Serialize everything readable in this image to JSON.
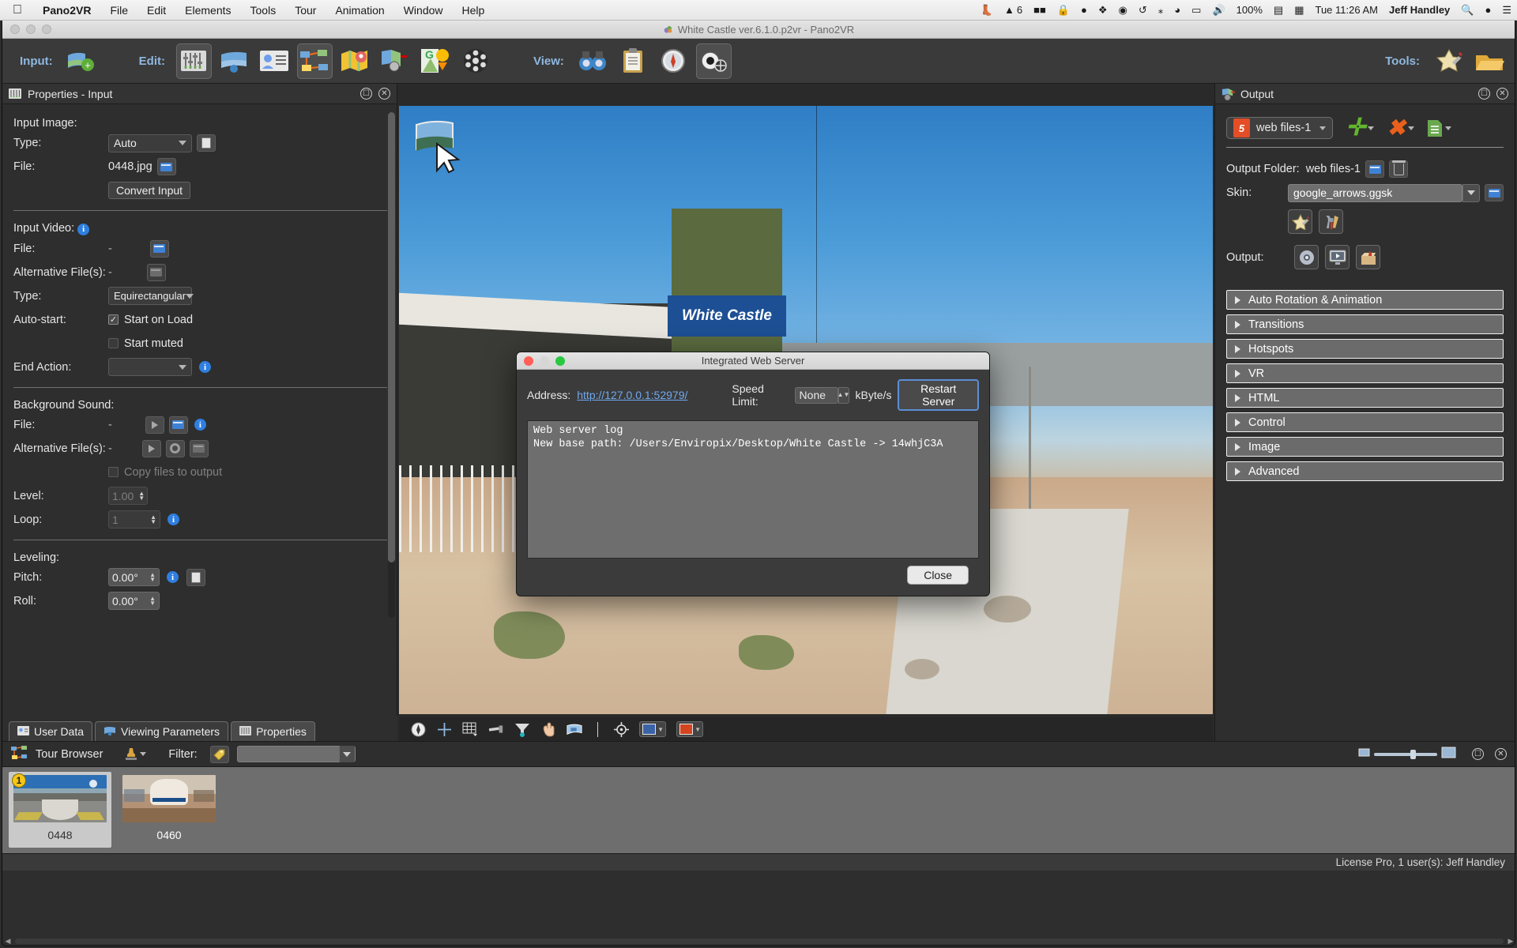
{
  "menubar": {
    "apple_icon": "apple-logo-icon",
    "items": [
      "Pano2VR",
      "File",
      "Edit",
      "Elements",
      "Tools",
      "Tour",
      "Animation",
      "Window",
      "Help"
    ],
    "status": {
      "evernote_icon": "evernote-icon",
      "acrobat_label": "6",
      "wetransfer_icon": "wetransfer-icon",
      "lock_icon": "lock-icon",
      "camera_icon": "camera-icon",
      "dropbox_icon": "dropbox-icon",
      "sophos_icon": "sophos-icon",
      "timemachine_icon": "time-machine-icon",
      "bluetooth_icon": "bluetooth-icon",
      "wifi_icon": "wifi-icon",
      "airplay_icon": "airplay-icon",
      "volume_icon": "volume-icon",
      "battery_percent": "100%",
      "battery_icon": "battery-charging-icon",
      "keyboard_icon": "input-source-icon",
      "clock": "Tue 11:26 AM",
      "user": "Jeff Handley",
      "search_icon": "spotlight-search-icon",
      "siri_icon": "siri-icon",
      "notification_icon": "notification-center-icon"
    }
  },
  "window": {
    "title": "White Castle ver.6.1.0.p2vr - Pano2VR",
    "title_icon": "pano2vr-app-icon"
  },
  "toolbar": {
    "input_label": "Input:",
    "edit_label": "Edit:",
    "view_label": "View:",
    "tools_label": "Tools:",
    "input_buttons": [
      {
        "name": "add-input-image-button",
        "icon": "panorama-add-icon"
      }
    ],
    "edit_buttons": [
      {
        "name": "properties-button",
        "icon": "sliders-icon",
        "selected": true
      },
      {
        "name": "viewing-parameters-button",
        "icon": "panorama-view-icon",
        "selected": false
      },
      {
        "name": "user-data-button",
        "icon": "user-card-icon",
        "selected": false
      },
      {
        "name": "tour-browser-button",
        "icon": "tour-nodes-icon",
        "selected": true
      },
      {
        "name": "tour-map-button",
        "icon": "map-pin-icon",
        "selected": false
      },
      {
        "name": "hotspot-editor-button",
        "icon": "hotspot-icon",
        "selected": false
      },
      {
        "name": "google-maps-button",
        "icon": "google-maps-icon",
        "selected": false
      },
      {
        "name": "animation-editor-button",
        "icon": "film-reel-icon",
        "selected": false
      }
    ],
    "view_buttons": [
      {
        "name": "binoculars-button",
        "icon": "binoculars-icon"
      },
      {
        "name": "clipboard-button",
        "icon": "clipboard-icon"
      },
      {
        "name": "compass-button",
        "icon": "compass-gauge-icon"
      },
      {
        "name": "preview-button",
        "icon": "preview-eye-icon",
        "selected": true
      }
    ],
    "tools_buttons": [
      {
        "name": "skin-editor-button",
        "icon": "skin-star-icon"
      },
      {
        "name": "output-button",
        "icon": "output-folder-icon"
      }
    ]
  },
  "left_panel": {
    "header": {
      "title": "Properties - Input",
      "icon": "sliders-icon",
      "float_icon": "undock-icon",
      "close_icon": "close-icon"
    },
    "sections": {
      "input_image": {
        "heading": "Input Image:",
        "type_label": "Type:",
        "type_value": "Auto",
        "copy_icon": "copy-icon",
        "file_label": "File:",
        "file_value": "0448.jpg",
        "folder_icon": "open-folder-icon",
        "convert_button": "Convert Input"
      },
      "input_video": {
        "heading": "Input Video:",
        "info_icon": "info-icon",
        "file_label": "File:",
        "file_value": "-",
        "alt_label": "Alternative File(s):",
        "alt_value": "-",
        "type_label": "Type:",
        "type_value": "Equirectangular",
        "autostart_label": "Auto-start:",
        "start_on_load": "Start on Load",
        "start_on_load_checked": true,
        "start_muted": "Start muted",
        "start_muted_checked": false,
        "end_action_label": "End Action:",
        "end_action_value": ""
      },
      "background_sound": {
        "heading": "Background Sound:",
        "file_label": "File:",
        "file_value": "-",
        "alt_label": "Alternative File(s):",
        "alt_value": "-",
        "copy_files_label": "Copy files to output",
        "copy_files_checked": false,
        "level_label": "Level:",
        "level_value": "1.00",
        "loop_label": "Loop:",
        "loop_value": "1"
      },
      "leveling": {
        "heading": "Leveling:",
        "pitch_label": "Pitch:",
        "pitch_value": "0.00°",
        "roll_label": "Roll:",
        "roll_value": "0.00°"
      }
    },
    "tabs": [
      {
        "label": "User Data",
        "icon": "user-card-icon",
        "active": false
      },
      {
        "label": "Viewing Parameters",
        "icon": "panorama-view-icon",
        "active": false
      },
      {
        "label": "Properties",
        "icon": "sliders-icon",
        "active": true
      }
    ]
  },
  "pano": {
    "sign_text": "White Castle",
    "node_icon": "panorama-node-icon",
    "cursor_icon": "mouse-cursor-icon",
    "tools": [
      {
        "name": "pan-tool-button",
        "icon": "compass-icon"
      },
      {
        "name": "north-marker-button",
        "icon": "crosshair-plus-icon"
      },
      {
        "name": "grid-button",
        "icon": "grid-icon"
      },
      {
        "name": "level-tool-button",
        "icon": "level-bar-icon"
      },
      {
        "name": "zenith-tool-button",
        "icon": "funnel-icon"
      },
      {
        "name": "hand-tool-button",
        "icon": "hand-icon"
      },
      {
        "name": "patch-tool-button",
        "icon": "patch-image-icon"
      },
      {
        "name": "target-button",
        "icon": "target-icon"
      },
      {
        "name": "blue-swatch-button",
        "icon": "color-swatch-blue-icon"
      },
      {
        "name": "red-swatch-button",
        "icon": "color-swatch-red-icon"
      }
    ]
  },
  "right_panel": {
    "header": {
      "title": "Output",
      "icon": "output-icon",
      "float_icon": "undock-icon",
      "close_icon": "close-icon"
    },
    "preset": {
      "label": "web files-1",
      "icon": "html5-icon"
    },
    "actions": [
      {
        "name": "add-output-button",
        "icon": "plus-icon"
      },
      {
        "name": "remove-output-button",
        "icon": "x-remove-icon"
      },
      {
        "name": "duplicate-output-button",
        "icon": "document-list-icon"
      }
    ],
    "output_folder_label": "Output Folder:",
    "output_folder_value": "web files-1",
    "output_folder_browse_icon": "open-folder-icon",
    "output_folder_delete_icon": "trash-icon",
    "skin_label": "Skin:",
    "skin_value": "google_arrows.ggsk",
    "skin_browse_icon": "open-folder-icon",
    "skin_buttons": [
      {
        "name": "edit-skin-button",
        "icon": "skin-star-icon"
      },
      {
        "name": "skin-settings-button",
        "icon": "tools-icon"
      }
    ],
    "output_label": "Output:",
    "output_buttons": [
      {
        "name": "output-settings-button",
        "icon": "gear-icon"
      },
      {
        "name": "output-preview-button",
        "icon": "monitor-play-icon"
      },
      {
        "name": "output-package-button",
        "icon": "package-box-icon"
      }
    ],
    "accordions": [
      "Auto Rotation & Animation",
      "Transitions",
      "Hotspots",
      "VR",
      "HTML",
      "Control",
      "Image",
      "Advanced"
    ]
  },
  "tour_browser": {
    "title": "Tour Browser",
    "icon": "tour-nodes-icon",
    "stamp_icon": "stamp-icon",
    "filter_label": "Filter:",
    "filter_icon": "tag-icon",
    "filter_value": "",
    "thumb_small_icon": "small-thumbnails-icon",
    "thumb_large_icon": "large-thumbnails-icon",
    "float_icon": "undock-icon",
    "close_icon": "close-icon",
    "nodes": [
      {
        "label": "0448",
        "badge": "1",
        "selected": true,
        "scene": "outdoor"
      },
      {
        "label": "0460",
        "badge": "",
        "selected": false,
        "scene": "indoor"
      }
    ]
  },
  "status_bar": {
    "license": "License Pro, 1 user(s): Jeff Handley"
  },
  "dialog": {
    "title": "Integrated Web Server",
    "address_label": "Address:",
    "address_value": "http://127.0.0.1:52979/",
    "speed_limit_label": "Speed Limit:",
    "speed_limit_value": "None",
    "speed_unit": "kByte/s",
    "restart_button": "Restart Server",
    "log": "Web server log\nNew base path: /Users/Enviropix/Desktop/White Castle -> 14whjC3A",
    "close_button": "Close",
    "traffic_lights": [
      "close-red",
      "minimize-yellow",
      "zoom-green"
    ]
  }
}
